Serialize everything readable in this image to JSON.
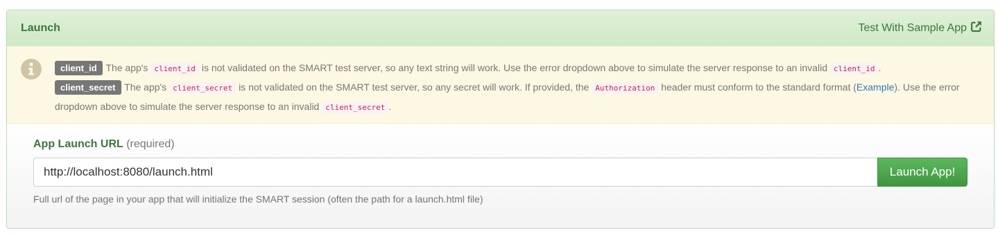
{
  "panel": {
    "title": "Launch",
    "sample_link": "Test With Sample App",
    "sample_link_icon": "external-link-icon"
  },
  "notice": {
    "icon": "info-icon",
    "client_id": {
      "label": "client_id",
      "text1": "The app's",
      "code": "client_id",
      "text2": "is not validated on the SMART test server, so any text string will work. Use the error dropdown above to simulate the server response to an invalid",
      "code_end": "client_id",
      "end": "."
    },
    "client_secret": {
      "label": "client_secret",
      "text1": "The app's",
      "code": "client_secret",
      "text2": "is not validated on the SMART test server, so any secret will work. If provided, the",
      "code_auth": "Authorization",
      "text3": "header must conform to the standard format (",
      "link": "Example",
      "text4": "). Use the error dropdown above to simulate the server response to an invalid",
      "code_end": "client_secret",
      "end": "."
    }
  },
  "form": {
    "label": "App Launch URL",
    "required": "(required)",
    "url_value": "http://localhost:8080/launch.html",
    "button": "Launch App!",
    "help": "Full url of the page in your app that will initialize the SMART session (often the path for a launch.html file)"
  },
  "colors": {
    "heading_bg": "#dff0d8",
    "heading_text": "#3c763d",
    "notice_bg": "#fcf8e3",
    "button_bg": "#5cb85c",
    "code_text": "#c7254e",
    "link": "#337ab7"
  }
}
